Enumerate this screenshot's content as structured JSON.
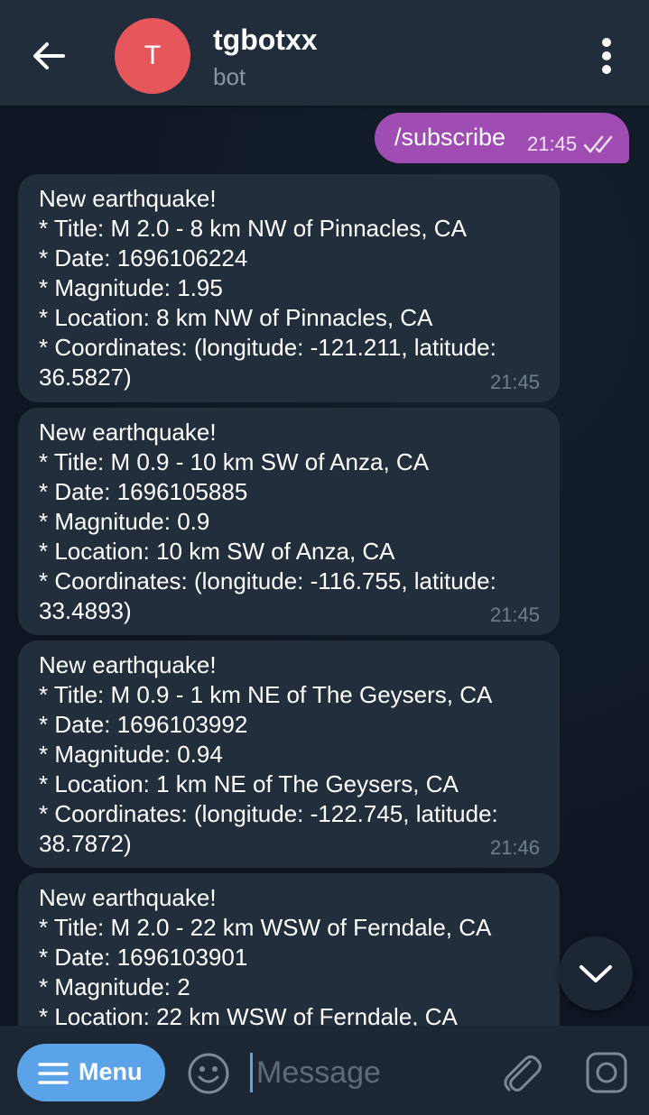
{
  "header": {
    "title": "tgbotxx",
    "subtitle": "bot",
    "avatar_letter": "T",
    "avatar_color": "#e5575a"
  },
  "outgoing": {
    "text": "/subscribe",
    "time": "21:45",
    "color": "#9f4db3"
  },
  "messages": [
    {
      "lines": [
        "New earthquake!",
        "* Title: M 2.0 - 8 km NW of Pinnacles, CA",
        "* Date: 1696106224",
        "* Magnitude: 1.95",
        "* Location: 8 km NW of Pinnacles, CA",
        "* Coordinates: (longitude: -121.211, latitude:",
        "36.5827)"
      ],
      "time": "21:45"
    },
    {
      "lines": [
        "New earthquake!",
        "* Title: M 0.9 - 10 km SW of Anza, CA",
        "* Date: 1696105885",
        "* Magnitude: 0.9",
        "* Location: 10 km SW of Anza, CA",
        "* Coordinates: (longitude: -116.755, latitude:",
        "33.4893)"
      ],
      "time": "21:45"
    },
    {
      "lines": [
        "New earthquake!",
        "* Title: M 0.9 - 1 km NE of The Geysers, CA",
        "* Date: 1696103992",
        "* Magnitude: 0.94",
        "* Location: 1 km NE of The Geysers, CA",
        "* Coordinates: (longitude: -122.745, latitude:",
        "38.7872)"
      ],
      "time": "21:46"
    },
    {
      "lines": [
        "New earthquake!",
        "* Title: M 2.0 - 22 km WSW of Ferndale, CA",
        "* Date: 1696103901",
        "* Magnitude: 2",
        "* Location: 22 km WSW of Ferndale, CA"
      ],
      "time": ""
    }
  ],
  "input": {
    "menu_label": "Menu",
    "placeholder": "Message",
    "value": ""
  },
  "icons": {
    "back": "arrow-left-icon",
    "more": "more-vertical-icon",
    "read": "double-check-icon",
    "scroll": "chevron-down-icon",
    "menu": "hamburger-icon",
    "emoji": "emoji-icon",
    "attach": "paperclip-icon",
    "camera": "camera-icon"
  },
  "colors": {
    "background": "#0e1621",
    "header": "#212d3b",
    "incoming_bubble": "#232e3c",
    "accent": "#5aa3e8"
  }
}
